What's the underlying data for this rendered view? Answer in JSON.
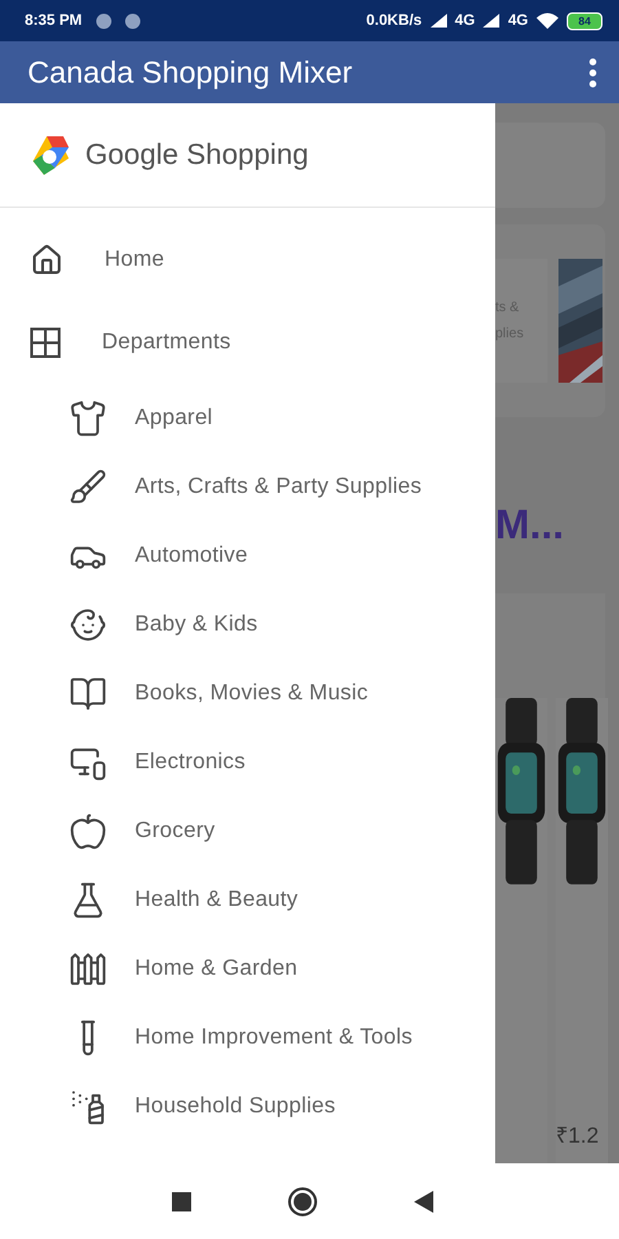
{
  "status_bar": {
    "time": "8:35 PM",
    "network_speed": "0.0KB/s",
    "sim_1": "4G",
    "sim_2": "4G",
    "battery": "84"
  },
  "app_bar": {
    "title": "Canada Shopping Mixer"
  },
  "drawer": {
    "logo_text": "Google Shopping",
    "items": [
      {
        "label": "Home"
      },
      {
        "label": "Departments",
        "children": [
          {
            "label": "Apparel"
          },
          {
            "label": "Arts, Crafts & Party Supplies"
          },
          {
            "label": "Automotive"
          },
          {
            "label": "Baby & Kids"
          },
          {
            "label": "Books, Movies & Music"
          },
          {
            "label": "Electronics"
          },
          {
            "label": "Grocery"
          },
          {
            "label": "Health & Beauty"
          },
          {
            "label": "Home & Garden"
          },
          {
            "label": "Home Improvement & Tools"
          },
          {
            "label": "Household Supplies"
          }
        ]
      }
    ]
  },
  "background": {
    "card_lines": [
      "ts &",
      "plies"
    ],
    "heading": "M...",
    "price": "₹1.2"
  }
}
